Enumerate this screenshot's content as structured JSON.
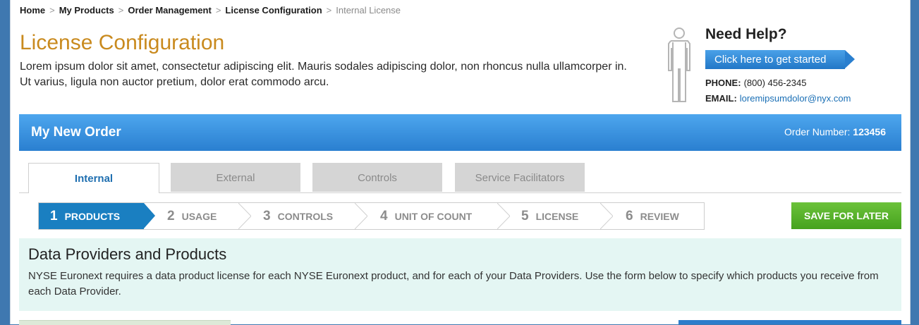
{
  "breadcrumb": {
    "items": [
      "Home",
      "My Products",
      "Order Management",
      "License Configuration"
    ],
    "current": "Internal License"
  },
  "page": {
    "title": "License Configuration",
    "intro": "Lorem ipsum dolor sit amet, consectetur adipiscing elit. Mauris sodales adipiscing dolor, non rhoncus nulla ullamcorper in. Ut varius, ligula non auctor pretium, dolor erat commodo arcu."
  },
  "help": {
    "title": "Need Help?",
    "button": "Click here to get started",
    "phone_label": "PHONE:",
    "phone": "(800) 456-2345",
    "email_label": "EMAIL:",
    "email": "loremipsumdolor@nyx.com"
  },
  "order": {
    "title": "My New Order",
    "number_label": "Order Number:",
    "number": "123456"
  },
  "tabs": [
    {
      "label": "Internal",
      "active": true
    },
    {
      "label": "External",
      "active": false
    },
    {
      "label": "Controls",
      "active": false
    },
    {
      "label": "Service Facilitators",
      "active": false
    }
  ],
  "steps": [
    {
      "num": "1",
      "label": "PRODUCTS",
      "active": true
    },
    {
      "num": "2",
      "label": "USAGE",
      "active": false
    },
    {
      "num": "3",
      "label": "CONTROLS",
      "active": false
    },
    {
      "num": "4",
      "label": "UNIT OF COUNT",
      "active": false
    },
    {
      "num": "5",
      "label": "LICENSE",
      "active": false
    },
    {
      "num": "6",
      "label": "REVIEW",
      "active": false
    }
  ],
  "save_button": "SAVE FOR LATER",
  "section": {
    "title": "Data Providers and Products",
    "text": "NYSE Euronext requires a data product license for each NYSE Euronext product, and for each of your Data Providers. Use the form below to specify which products you receive from each Data Provider."
  },
  "colors": {
    "accent_orange": "#c98a1e",
    "primary_blue": "#2a7fd0",
    "save_green": "#46a21e",
    "panel_bg": "#e4f6f3"
  }
}
